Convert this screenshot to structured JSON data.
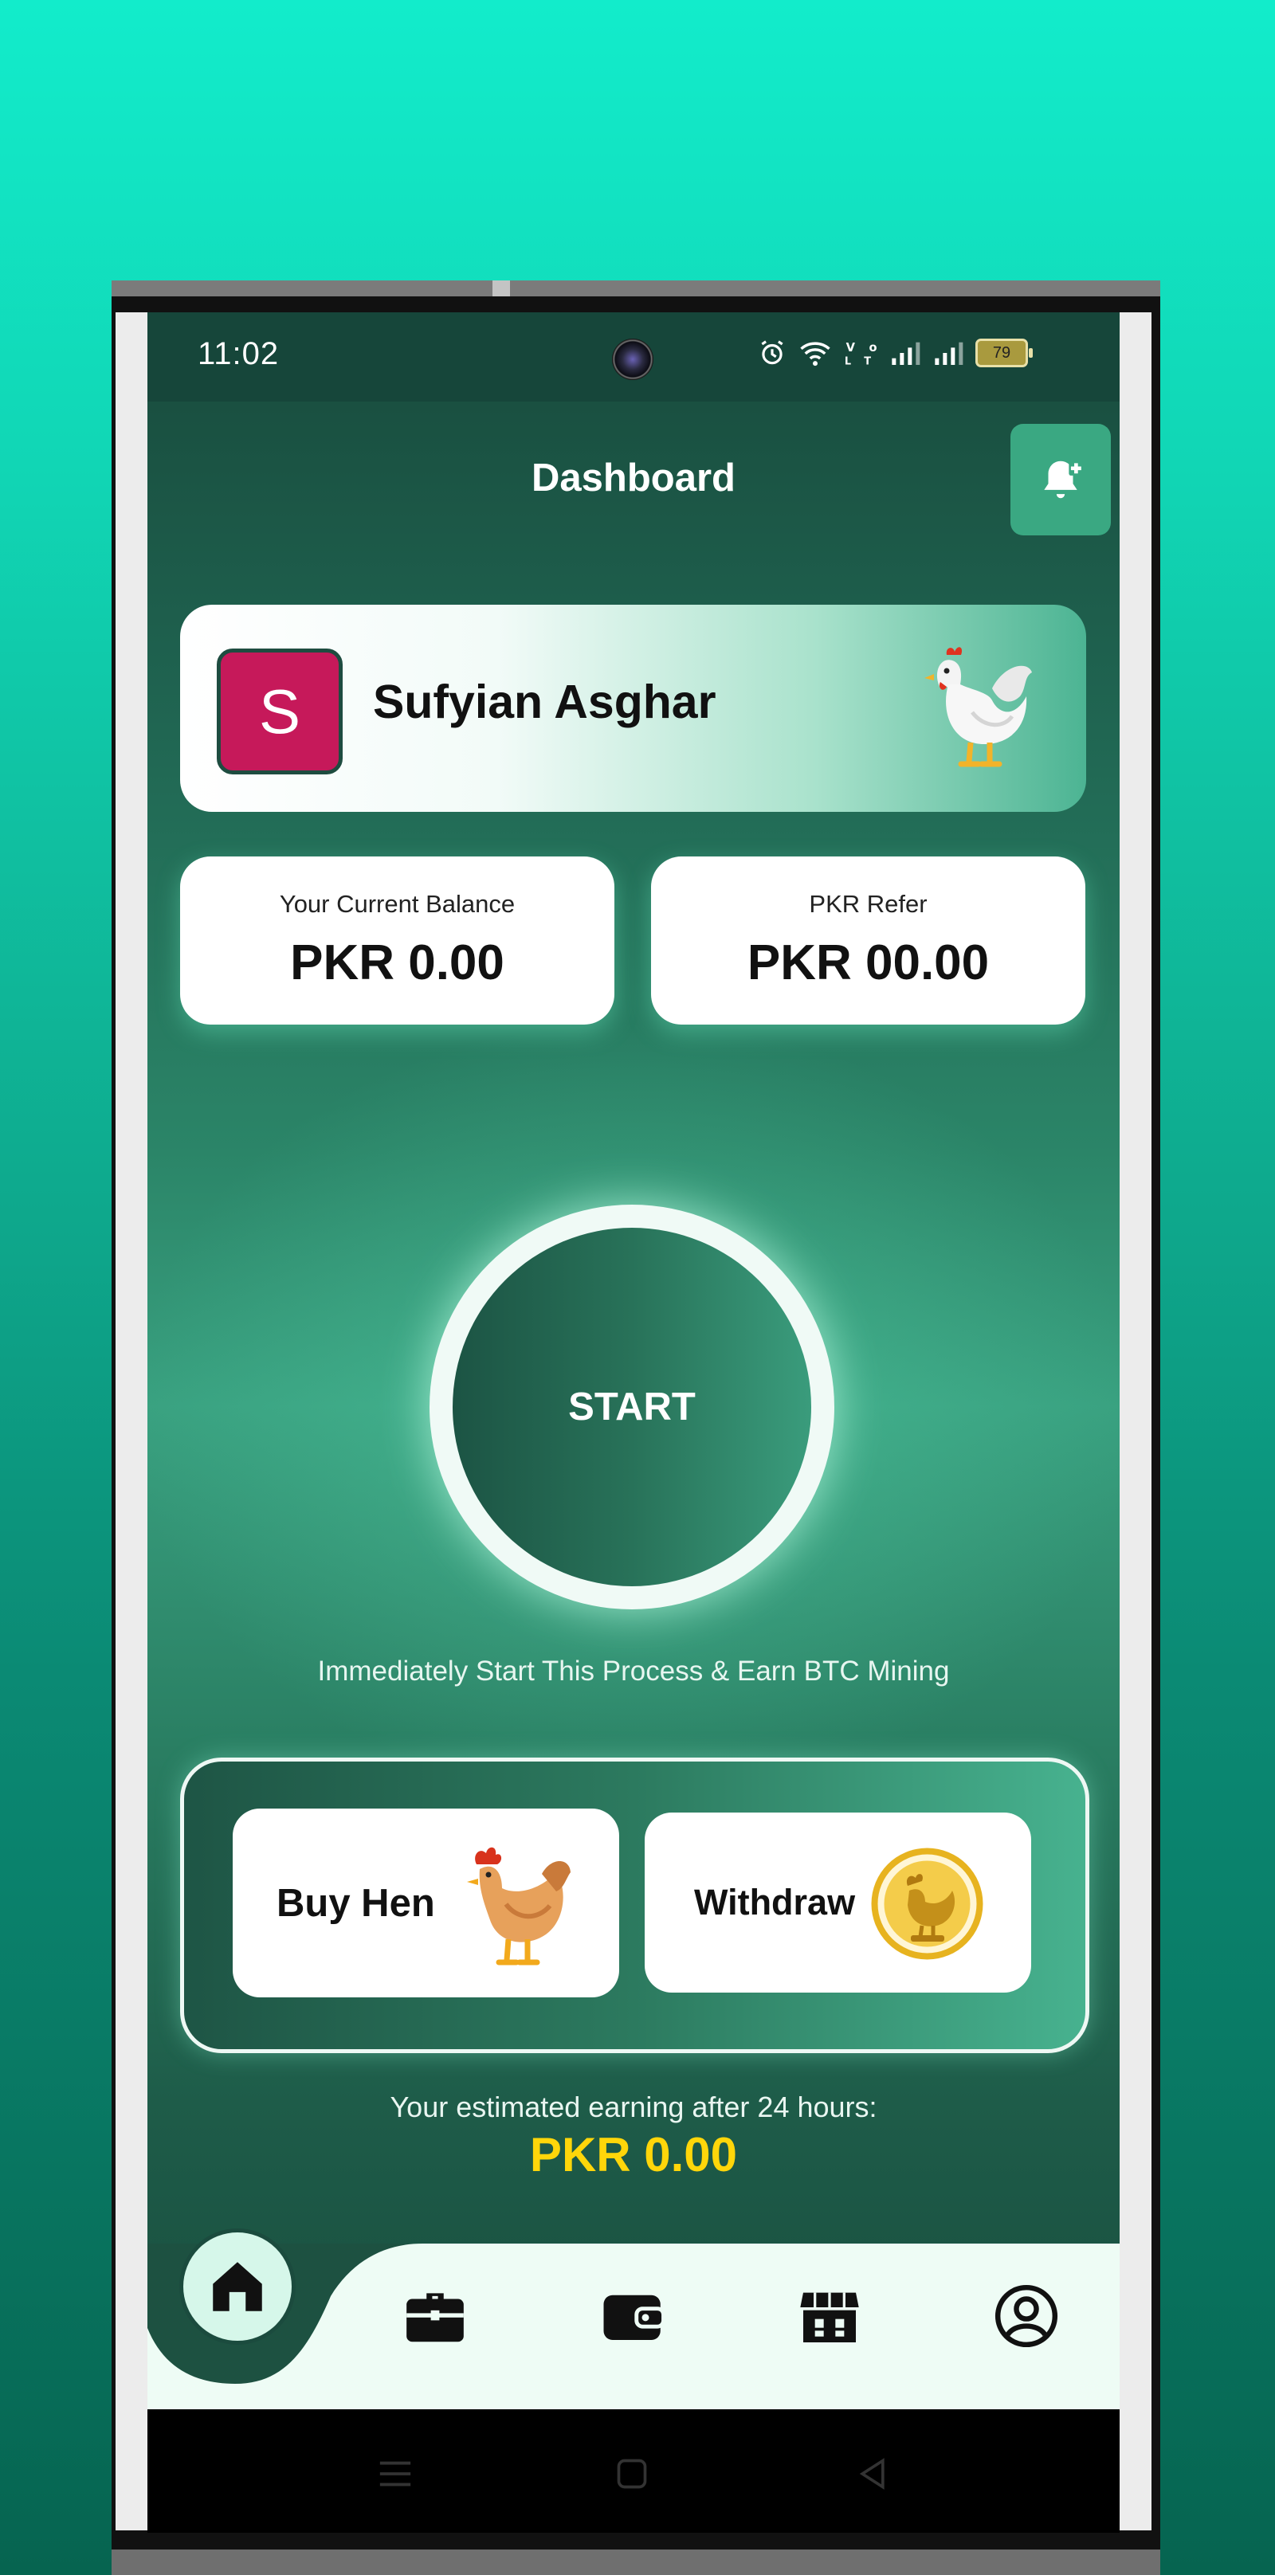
{
  "status_bar": {
    "time": "11:02",
    "battery": "79"
  },
  "header": {
    "title": "Dashboard",
    "notification_icon": "bell-plus-icon"
  },
  "profile": {
    "initial": "S",
    "name": "Sufyian Asghar",
    "avatar_color": "#c6195a"
  },
  "balances": {
    "current_label": "Your Current Balance",
    "current_value": "PKR 0.00",
    "refer_label": "PKR Refer",
    "refer_value": "PKR 00.00"
  },
  "start": {
    "label": "START",
    "caption": "Immediately Start This Process & Earn BTC Mining"
  },
  "actions": {
    "buy_label": "Buy Hen",
    "withdraw_label": "Withdraw"
  },
  "estimate": {
    "label": "Your estimated earning after 24 hours:",
    "value": "PKR 0.00",
    "value_color": "#ffd60a"
  },
  "bottom_nav": {
    "items": [
      {
        "icon": "home-icon",
        "active": true
      },
      {
        "icon": "briefcase-icon",
        "active": false
      },
      {
        "icon": "wallet-icon",
        "active": false
      },
      {
        "icon": "store-icon",
        "active": false
      },
      {
        "icon": "profile-icon",
        "active": false
      }
    ]
  },
  "colors": {
    "accent": "#3aa882",
    "dark_green": "#1b4b3e",
    "nav_background": "#eefcf5"
  }
}
